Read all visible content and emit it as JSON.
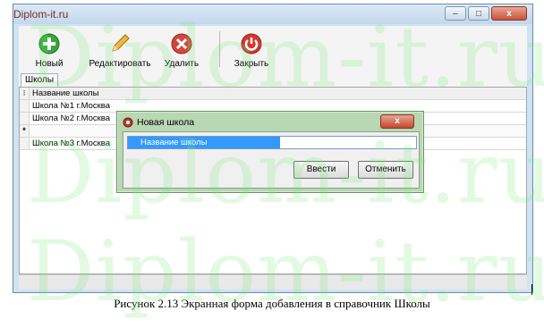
{
  "window": {
    "title": "Diplom-it.ru",
    "controls": {
      "minimize": "–",
      "maximize": "□",
      "close": "x"
    }
  },
  "toolbar": {
    "buttons": [
      {
        "label": "Новый",
        "icon": "add-icon",
        "color": "#3aa63a"
      },
      {
        "label": "Редактировать",
        "icon": "pencil-icon",
        "color": "#e0a020"
      },
      {
        "label": "Удалить",
        "icon": "delete-icon",
        "color": "#d4473b"
      },
      {
        "label": "Закрыть",
        "icon": "power-icon",
        "color": "#d23a2e"
      }
    ]
  },
  "tabs": [
    {
      "label": "Школы"
    }
  ],
  "grid": {
    "column_header": "Название школы",
    "rows": [
      {
        "marker": "",
        "name": "Школа №1 г.Москва"
      },
      {
        "marker": "",
        "name": "Школа №2 г.Москва"
      },
      {
        "marker": "*",
        "name": ""
      },
      {
        "marker": "",
        "name": "Школа №3 г.Москва"
      }
    ]
  },
  "dialog": {
    "title": "Новая школа",
    "close_label": "x",
    "field_label": "Название школы",
    "field_value": "",
    "buttons": {
      "ok": "Ввести",
      "cancel": "Отменить"
    }
  },
  "caption": "Рисунок 2.13 Экранная форма добавления в справочник Школы",
  "watermark": "Diplom-it.ru",
  "colors": {
    "selection": "#3399ff",
    "dialog_frame": "#b7d8b2",
    "window_frame": "#cfe3f3"
  }
}
